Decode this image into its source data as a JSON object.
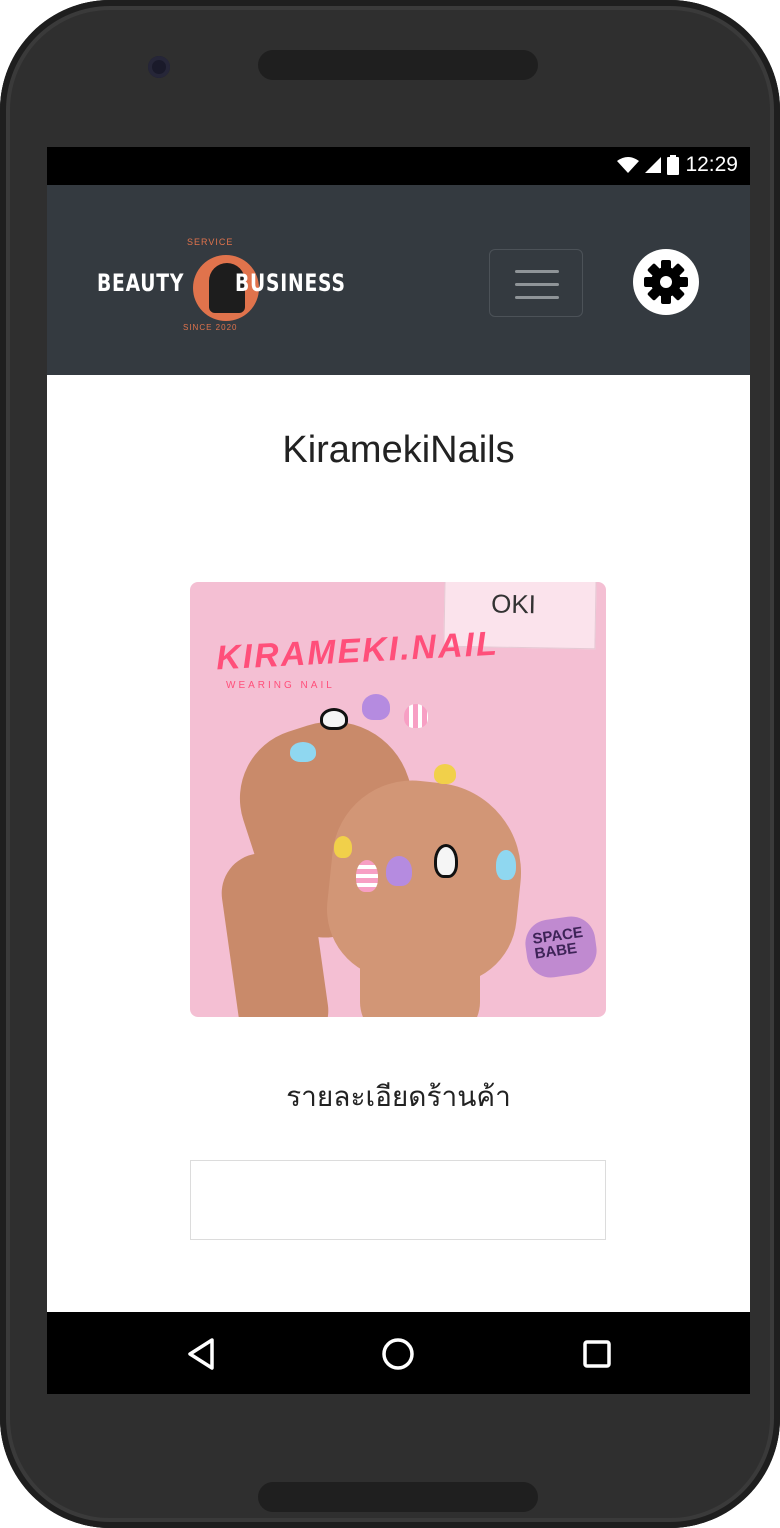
{
  "status_bar": {
    "time": "12:29",
    "icons": [
      "wifi-icon",
      "signal-icon",
      "battery-icon"
    ]
  },
  "navbar": {
    "logo": {
      "service": "SERVICE",
      "beauty": "BEAUTY",
      "business": "BUSINESS",
      "since": "SINCE 2020"
    },
    "menu_icon": "hamburger-menu-icon",
    "settings_icon": "gear-icon"
  },
  "main": {
    "shop_name": "KiramekiNails",
    "photo": {
      "sign_text": "KIRAMEKI.NAIL",
      "sub_text": "WEARING NAIL",
      "card_text": "OKI",
      "sticker_text": "SPACE BABE"
    },
    "section_title": "รายละเอียดร้านค้า"
  },
  "system_nav": {
    "back_icon": "back-triangle-icon",
    "home_icon": "home-circle-icon",
    "recents_icon": "recents-square-icon"
  },
  "colors": {
    "navbar_bg": "#343a40",
    "logo_accent": "#e0734c",
    "photo_bg": "#f4bfd3"
  }
}
